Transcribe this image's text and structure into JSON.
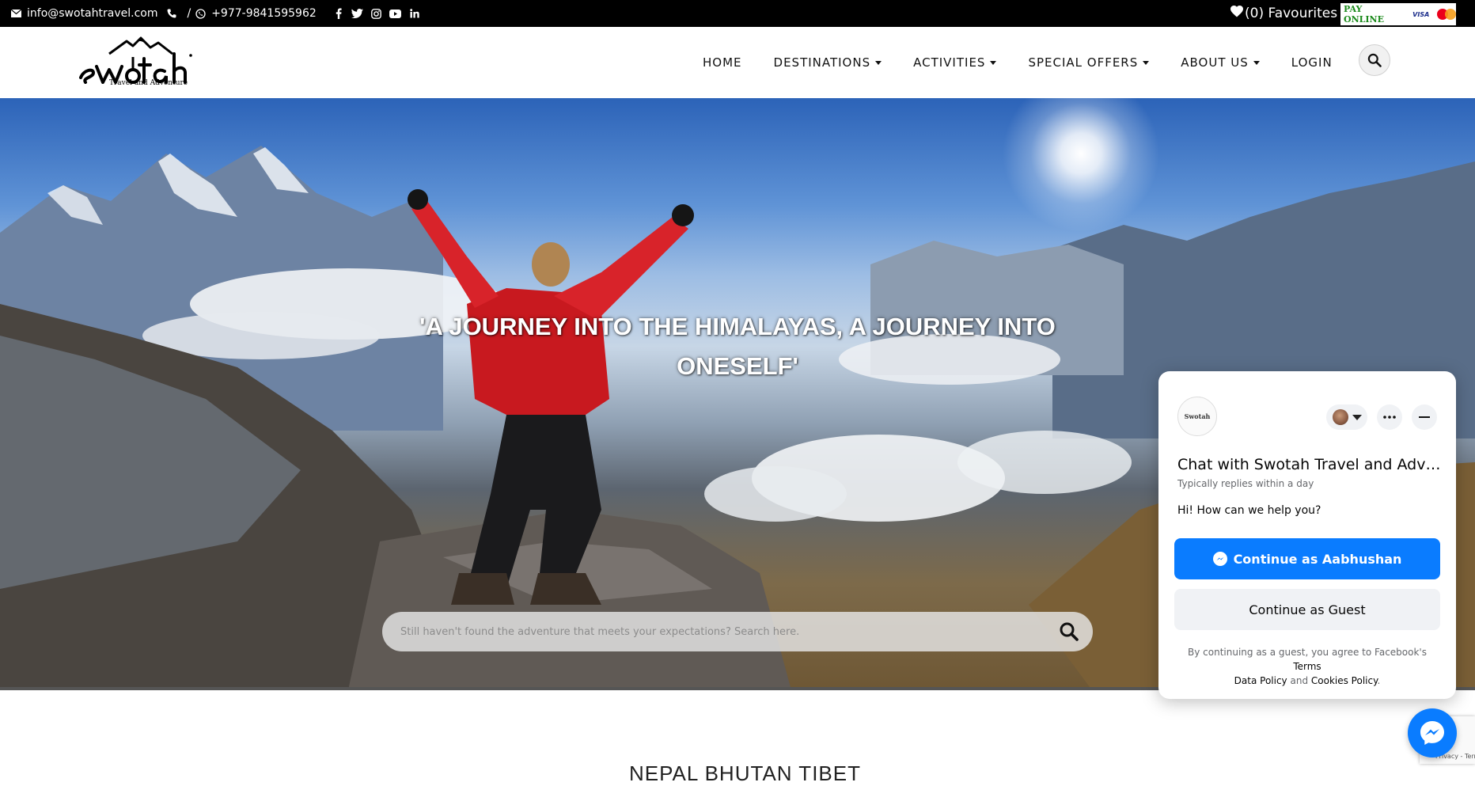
{
  "topbar": {
    "email": "info@swotahtravel.com",
    "separator": "/",
    "phone": "+977-9841595962",
    "favourites": "(0) Favourites",
    "pay_online": "PAY ONLINE",
    "visa": "VISA"
  },
  "logo": {
    "tagline": "Travel and Adventure"
  },
  "nav": {
    "items": [
      {
        "label": "HOME",
        "dropdown": false
      },
      {
        "label": "DESTINATIONS",
        "dropdown": true
      },
      {
        "label": "ACTIVITIES",
        "dropdown": true
      },
      {
        "label": "SPECIAL OFFERS",
        "dropdown": true
      },
      {
        "label": "ABOUT US",
        "dropdown": true
      },
      {
        "label": "LOGIN",
        "dropdown": false
      }
    ]
  },
  "hero": {
    "title": "'A JOURNEY INTO THE HIMALAYAS, A JOURNEY INTO ONESELF'",
    "search_placeholder": "Still haven't found the adventure that meets your expectations? Search here."
  },
  "section": {
    "title": "NEPAL BHUTAN TIBET"
  },
  "chat": {
    "avatar_text": "Swotah",
    "title": "Chat with Swotah Travel and Adve...",
    "subtitle": "Typically replies within a day",
    "message": "Hi! How can we help you?",
    "continue_user": "Continue as Aabhushan",
    "continue_guest": "Continue as Guest",
    "legal_prefix": "By continuing as a guest, you agree to Facebook's",
    "terms": "Terms",
    "data_policy": "Data Policy",
    "and": "and",
    "cookies_policy": "Cookies Policy",
    "period": "."
  },
  "recaptcha": {
    "links": "Privacy - Terms"
  },
  "colors": {
    "messenger_blue": "#0a7cff",
    "pay_online_green": "#1b8a1b"
  }
}
